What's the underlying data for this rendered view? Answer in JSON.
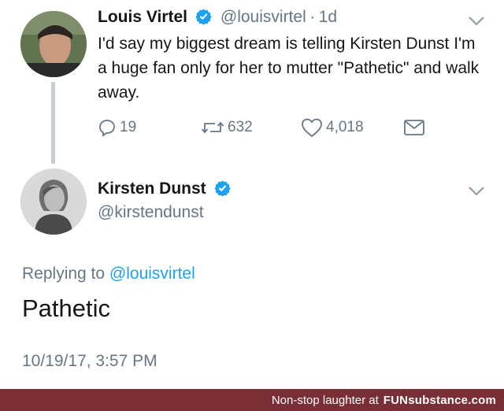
{
  "tweet1": {
    "name": "Louis Virtel",
    "handle": "@louisvirtel",
    "separator": "·",
    "age": "1d",
    "text": "I'd say my biggest dream is telling Kirsten Dunst I'm a huge fan only for her to mutter \"Pathetic\" and walk away.",
    "replies": "19",
    "retweets": "632",
    "likes": "4,018"
  },
  "tweet2": {
    "name": "Kirsten Dunst",
    "handle": "@kirstendunst",
    "replying_prefix": "Replying to",
    "replying_mention": "@louisvirtel",
    "text": "Pathetic",
    "timestamp": "10/19/17, 3:57 PM"
  },
  "footer": {
    "caption": "Non-stop laughter at",
    "brand": "FUNsubstance.com"
  },
  "colors": {
    "verified": "#1da1f2",
    "muted": "#657786",
    "link": "#1da1f2",
    "footer_bg": "#7a2e35"
  },
  "icons": [
    "verified-badge-icon",
    "chevron-down-icon",
    "reply-icon",
    "retweet-icon",
    "like-icon",
    "direct-message-icon"
  ]
}
